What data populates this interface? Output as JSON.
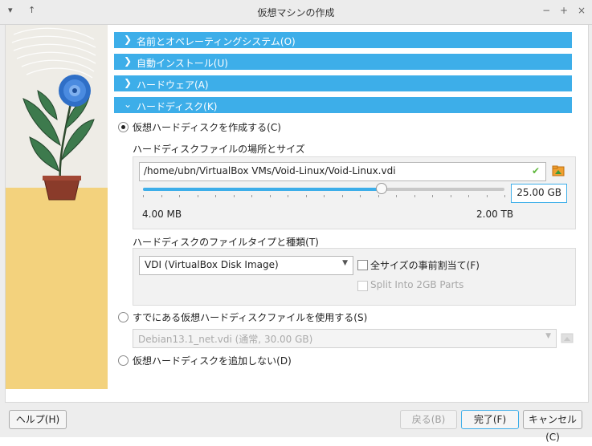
{
  "window": {
    "title": "仮想マシンの作成"
  },
  "titlebar": {
    "left_controls": "▾ ↑",
    "minimize": "−",
    "maximize": "+",
    "close": "×"
  },
  "sections": [
    {
      "label": "名前とオペレーティングシステム(O)",
      "expanded": false
    },
    {
      "label": "自動インストール(U)",
      "expanded": false
    },
    {
      "label": "ハードウェア(A)",
      "expanded": false
    },
    {
      "label": "ハードディスク(K)",
      "expanded": true
    }
  ],
  "disk": {
    "create_label": "仮想ハードディスクを作成する(C)",
    "location_size_label": "ハードディスクファイルの場所とサイズ",
    "path_value": "/home/ubn/VirtualBox VMs/Void-Linux/Void-Linux.vdi",
    "size_value": "25.00 GB",
    "min_label": "4.00 MB",
    "max_label": "2.00 TB",
    "slider_fraction": 0.66,
    "filetype_label": "ハードディスクのファイルタイプと種類(T)",
    "filetype_value": "VDI (VirtualBox Disk Image)",
    "prealloc_label": "全サイズの事前割当て(F)",
    "split_label": "Split Into 2GB Parts",
    "existing_label": "すでにある仮想ハードディスクファイルを使用する(S)",
    "existing_value": "Debian13.1_net.vdi (通常, 30.00 GB)",
    "none_label": "仮想ハードディスクを追加しない(D)"
  },
  "buttons": {
    "help": "ヘルプ(H)",
    "back": "戻る(B)",
    "finish": "完了(F)",
    "cancel": "キャンセル(C)"
  },
  "colors": {
    "accent": "#3daee9",
    "check_ok": "#5fb83c"
  }
}
